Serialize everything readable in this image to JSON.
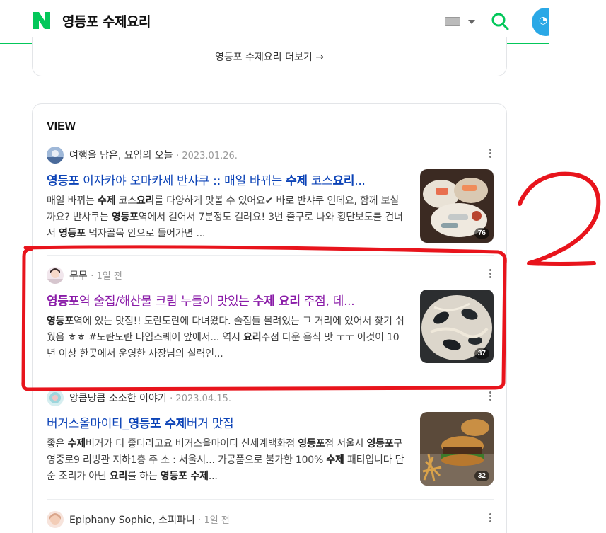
{
  "header": {
    "query": "영등포 수제요리",
    "logo_letter": "N",
    "brand_color": "#03c75a",
    "icons": [
      "keyboard-icon",
      "dropdown-caret-icon",
      "search-icon",
      "profile-icon"
    ]
  },
  "more": {
    "label": "영등포 수제요리 더보기 →"
  },
  "view": {
    "title": "VIEW",
    "posts": [
      {
        "author": "여행을 담은, 요임의 오늘",
        "date": "2023.01.26.",
        "title_parts": [
          [
            "영등포",
            true
          ],
          [
            " 이자카야 오마카세 반샤쿠 :: 매일 바뀌는 ",
            false
          ],
          [
            "수제",
            true
          ],
          [
            " 코스",
            false
          ],
          [
            "요리",
            true
          ],
          [
            "...",
            false
          ]
        ],
        "snippet_parts": [
          [
            "매일 바뀌는 ",
            false
          ],
          [
            "수제",
            true
          ],
          [
            " 코스",
            false
          ],
          [
            "요리",
            true
          ],
          [
            "를 다양하게 맛볼 수 있어요✔ 바로 반샤쿠 인데요, 함께 보실까요? 반샤쿠는 ",
            false
          ],
          [
            "영등포",
            true
          ],
          [
            "역에서 걸어서 7분정도 걸려요! 3번 출구로 나와 횡단보도를 건너서 ",
            false
          ],
          [
            "영등포",
            true
          ],
          [
            " 먹자골목 안으로 들어가면 ...",
            false
          ]
        ],
        "image_count": "76",
        "visited": false
      },
      {
        "author": "무무",
        "date": "1일 전",
        "title_parts": [
          [
            "영등포",
            true
          ],
          [
            "역 술집/해산물 크림 누들이 맛있는 ",
            false
          ],
          [
            "수제 요리",
            true
          ],
          [
            " 주점, 데...",
            false
          ]
        ],
        "snippet_parts": [
          [
            "영등포",
            true
          ],
          [
            "역에 있는 맛집!! 도란도란에 다녀왔다. 술집들 몰려있는 그 거리에 있어서 찾기 쉬웠음 ㅎㅎ #도란도란 타임스퀘어 앞에서... 역시 ",
            false
          ],
          [
            "요리",
            true
          ],
          [
            "주점 다운 음식 맛 ㅜㅜ 이것이 10년 이상 한곳에서 운영한 사장님의 실력인...",
            false
          ]
        ],
        "image_count": "37",
        "visited": true
      },
      {
        "author": "앙큼당큼 소소한 이야기",
        "date": "2023.04.15.",
        "title_parts": [
          [
            "버거스올마이티_",
            false
          ],
          [
            "영등포 수제",
            true
          ],
          [
            "버거 맛집",
            false
          ]
        ],
        "snippet_parts": [
          [
            "좋은 ",
            false
          ],
          [
            "수제",
            true
          ],
          [
            "버거가 더 좋더라고요 버거스올마이티 신세계백화점 ",
            false
          ],
          [
            "영등포",
            true
          ],
          [
            "점 서울시 ",
            false
          ],
          [
            "영등포",
            true
          ],
          [
            "구 영중로9 리빙관 지하1층 주 소 : 서울시... 가공품으로 불가한 100% ",
            false
          ],
          [
            "수제",
            true
          ],
          [
            " 패티입니다 단순 조리가 아닌 ",
            false
          ],
          [
            "요리",
            true
          ],
          [
            "를 하는 ",
            false
          ],
          [
            "영등포 수제",
            true
          ],
          [
            "...",
            false
          ]
        ],
        "image_count": "32",
        "visited": false
      },
      {
        "author": "Epiphany Sophie, 소피파니",
        "date": "1일 전"
      }
    ]
  },
  "annotation": {
    "label": "2",
    "color": "#e8141c"
  }
}
